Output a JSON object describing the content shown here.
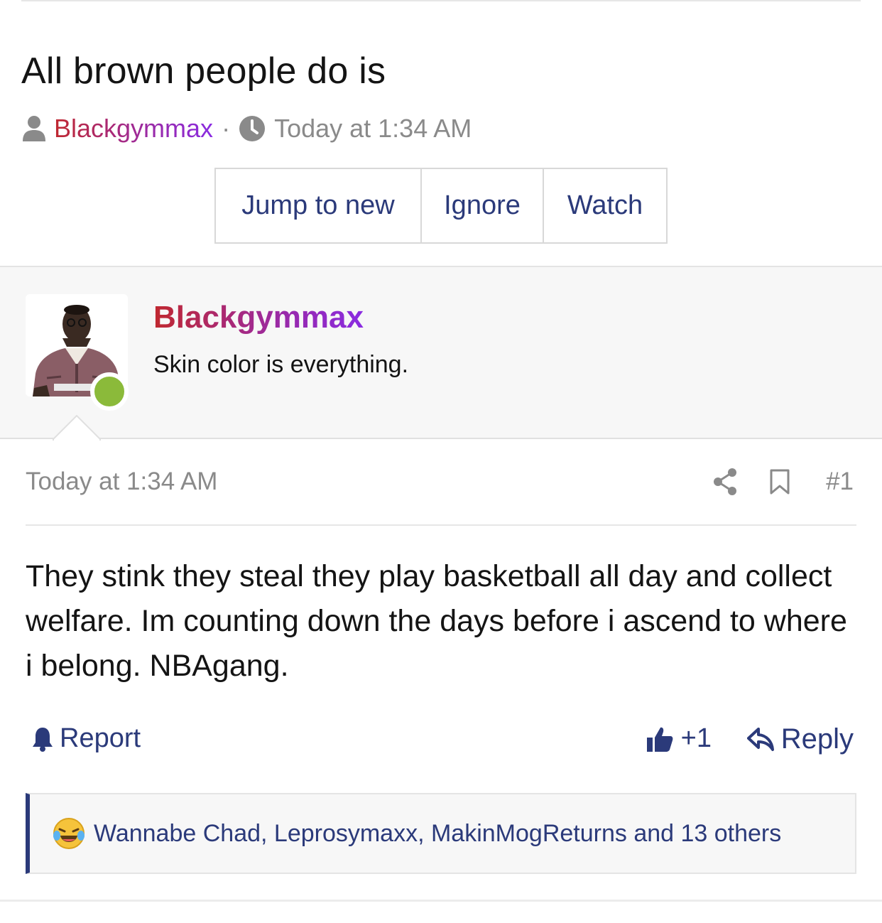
{
  "thread": {
    "title": "All brown people do is",
    "author": "Blackgymmax",
    "separator": "·",
    "timestamp": "Today at 1:34 AM"
  },
  "buttons": {
    "jump_to_new": "Jump to new",
    "ignore": "Ignore",
    "watch": "Watch"
  },
  "post": {
    "author": "Blackgymmax",
    "user_title": "Skin color is everything.",
    "date": "Today at 1:34 AM",
    "number": "#1",
    "body": "They stink they steal they play basketball all day and collect welfare. Im counting down the days before i ascend to where i belong. NBAgang.",
    "report_label": "Report",
    "like_label": "+1",
    "reply_label": "Reply",
    "reactions_text": "Wannabe Chad, Leprosymaxx, MakinMogReturns and 13 others"
  },
  "icons": {
    "user": "user-icon",
    "clock": "clock-icon",
    "share": "share-icon",
    "bookmark": "bookmark-icon",
    "bell": "bell-icon",
    "thumb": "thumbs-up-icon",
    "reply": "reply-arrow-icon",
    "reaction": "laughing-tears-emoji-icon"
  },
  "colors": {
    "link": "#2b3a7a",
    "muted": "#8a8a8a",
    "online": "#8bba3a",
    "username_gradient_start": "#c0282f",
    "username_gradient_end": "#8a2be2"
  }
}
